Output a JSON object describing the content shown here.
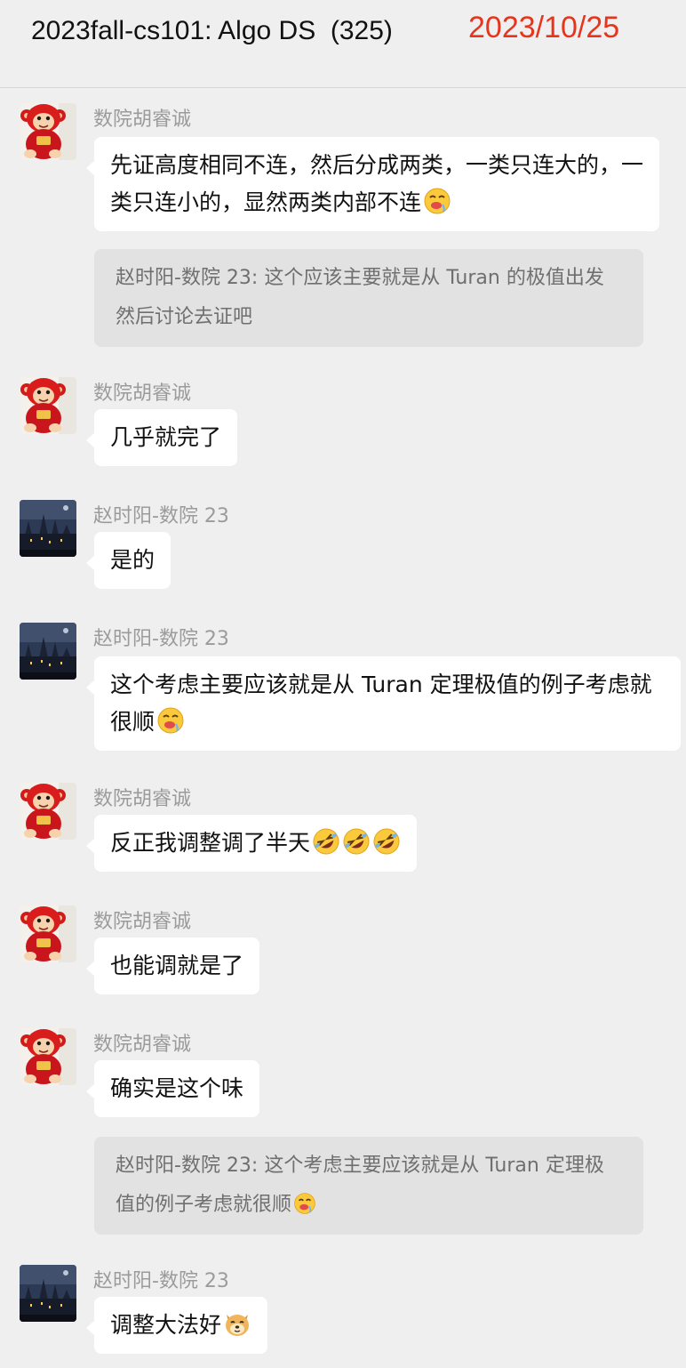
{
  "header": {
    "title": "2023fall-cs101: Algo DS  (325)",
    "date": "2023/10/25"
  },
  "messages": [
    {
      "sender": "数院胡睿诚",
      "avatar": "red-monkey-avatar",
      "text": "先证高度相同不连，然后分成两类，一类只连大的，一类只连小的，显然两类内部不连",
      "emoji": [
        "drooling-face-emoji"
      ],
      "quote": "赵时阳-数院 23: 这个应该主要就是从 Turan 的极值出发然后讨论去证吧"
    },
    {
      "sender": "数院胡睿诚",
      "avatar": "red-monkey-avatar",
      "text": "几乎就完了",
      "emoji": []
    },
    {
      "sender": "赵时阳-数院 23",
      "avatar": "night-castle-avatar",
      "text": "是的",
      "emoji": []
    },
    {
      "sender": "赵时阳-数院 23",
      "avatar": "night-castle-avatar",
      "text": "这个考虑主要应该就是从 Turan 定理极值的例子考虑就很顺",
      "emoji": [
        "drooling-face-emoji"
      ]
    },
    {
      "sender": "数院胡睿诚",
      "avatar": "red-monkey-avatar",
      "text": "反正我调整调了半天",
      "emoji": [
        "rolling-laughing-emoji",
        "rolling-laughing-emoji",
        "rolling-laughing-emoji"
      ]
    },
    {
      "sender": "数院胡睿诚",
      "avatar": "red-monkey-avatar",
      "text": "也能调就是了",
      "emoji": []
    },
    {
      "sender": "数院胡睿诚",
      "avatar": "red-monkey-avatar",
      "text": "确实是这个味",
      "emoji": [],
      "quote": "赵时阳-数院 23: 这个考虑主要应该就是从 Turan 定理极值的例子考虑就很顺"
    },
    {
      "sender": "赵时阳-数院 23",
      "avatar": "night-castle-avatar",
      "text": "调整大法好",
      "emoji": [
        "doge-emoji"
      ]
    }
  ]
}
